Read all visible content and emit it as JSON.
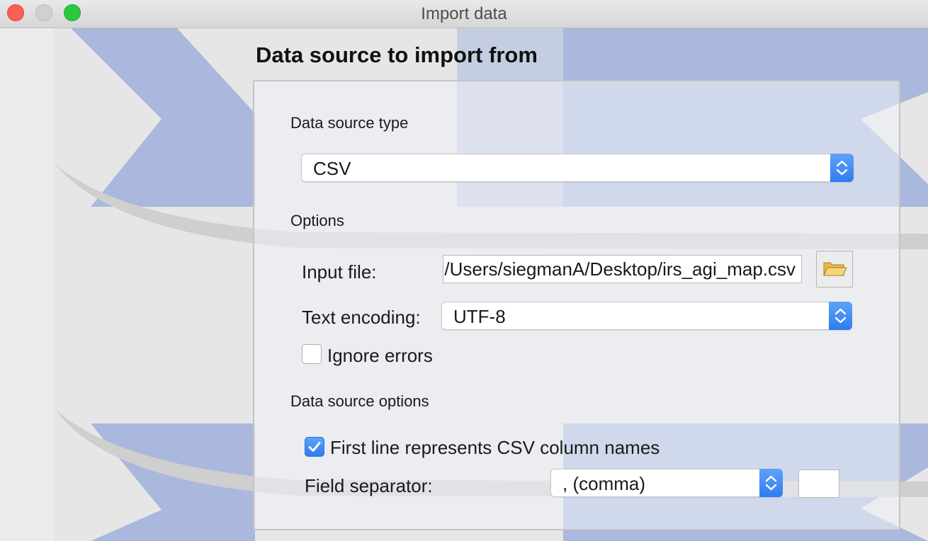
{
  "window": {
    "title": "Import data"
  },
  "page": {
    "heading": "Data source to import from"
  },
  "data_source": {
    "section_label": "Data source type",
    "type_value": "CSV"
  },
  "options": {
    "section_label": "Options",
    "input_file_label": "Input file:",
    "input_file_value": "/Users/siegmanA/Desktop/irs_agi_map.csv",
    "text_encoding_label": "Text encoding:",
    "text_encoding_value": "UTF-8",
    "ignore_errors_label": "Ignore errors",
    "ignore_errors_checked": false
  },
  "source_options": {
    "section_label": "Data source options",
    "first_line_label": "First line represents CSV column names",
    "first_line_checked": true,
    "field_separator_label": "Field separator:",
    "field_separator_value": ", (comma)",
    "custom_separator_value": ""
  },
  "colors": {
    "accent": "#2f7cf0",
    "watermark_blue": "#a9b8dc",
    "close_button": "#fc5f57",
    "zoom_button": "#2dc73f"
  },
  "icons": {
    "browse": "folder-open-icon",
    "select": "chevron-up-down-icon",
    "check": "checkmark-icon"
  }
}
